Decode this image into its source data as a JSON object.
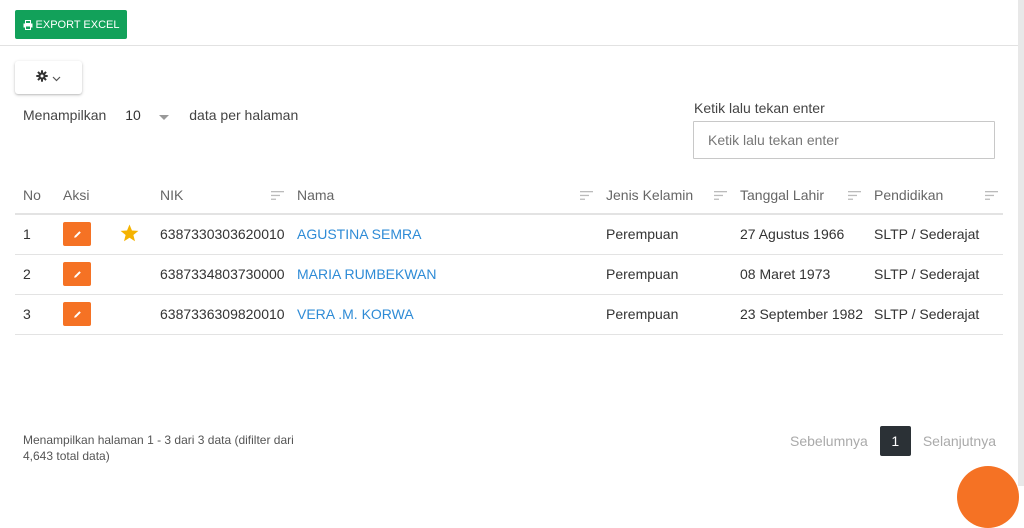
{
  "toolbar": {
    "export_label": "EXPORT EXCEL",
    "export_icon": "printer-icon",
    "export_color": "#12a15a",
    "settings_icon": "gear-icon",
    "settings_caret_icon": "chevron-down-icon"
  },
  "perpage": {
    "prefix": "Menampilkan",
    "value": "10",
    "suffix": "data per halaman"
  },
  "search": {
    "label": "Ketik lalu tekan enter",
    "placeholder": "Ketik lalu tekan enter",
    "value": ""
  },
  "table": {
    "columns": [
      "No",
      "Aksi",
      "NIK",
      "Nama",
      "Jenis Kelamin",
      "Tanggal Lahir",
      "Pendidikan"
    ],
    "rows": [
      {
        "no": "1",
        "starred": true,
        "nik": "6387330303620010",
        "nama": "AGUSTINA SEMRA",
        "jenis_kelamin": "Perempuan",
        "tanggal_lahir": "27 Agustus 1966",
        "pendidikan": "SLTP / Sederajat"
      },
      {
        "no": "2",
        "starred": false,
        "nik": "6387334803730000",
        "nama": "MARIA RUMBEKWAN",
        "jenis_kelamin": "Perempuan",
        "tanggal_lahir": "08 Maret 1973",
        "pendidikan": "SLTP / Sederajat"
      },
      {
        "no": "3",
        "starred": false,
        "nik": "6387336309820010",
        "nama": "VERA .M. KORWA",
        "jenis_kelamin": "Perempuan",
        "tanggal_lahir": "23 September 1982",
        "pendidikan": "SLTP / Sederajat"
      }
    ]
  },
  "footer": {
    "info": "Menampilkan halaman 1 - 3 dari 3 data (difilter dari 4,643 total data)",
    "prev_label": "Sebelumnya",
    "current_page": "1",
    "next_label": "Selanjutnya"
  },
  "colors": {
    "accent_orange": "#f57224",
    "link_blue": "#2e8bd6",
    "star_gold": "#f5b301",
    "pagination_active": "#2b3136"
  }
}
